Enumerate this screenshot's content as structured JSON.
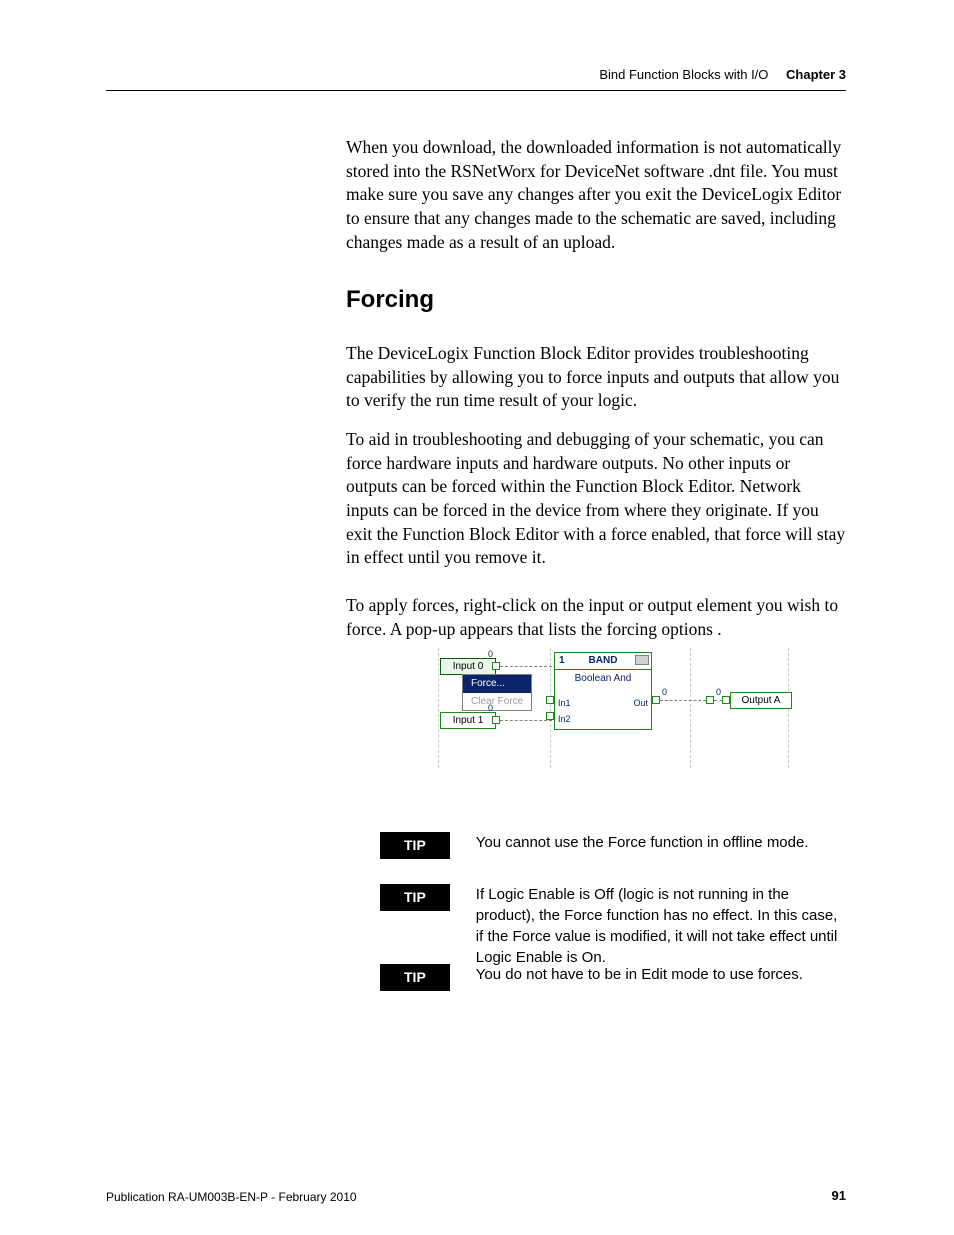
{
  "header": {
    "section": "Bind Function Blocks with I/O",
    "chapter": "Chapter 3"
  },
  "body": {
    "p1": "When you download, the downloaded information is not automatically stored into the RSNetWorx for DeviceNet software .dnt file. You must make sure you save any changes after you exit the DeviceLogix Editor to ensure that any changes made to the schematic are saved, including changes made as a result of an upload.",
    "h2": "Forcing",
    "p2": "The DeviceLogix Function Block Editor provides troubleshooting capabilities by allowing you to force inputs and outputs that allow you to verify the run time result of your logic.",
    "p3": "To aid in troubleshooting and debugging of your schematic, you can force hardware inputs and hardware outputs. No other inputs or outputs can be forced within the Function Block Editor. Network inputs can be forced in the device from where they originate. If you exit the Function Block Editor with a force enabled, that force will stay in effect until you remove it.",
    "p4": "To apply forces, right-click on the input or output element you wish to force. A pop-up appears that lists the forcing options ."
  },
  "diagram": {
    "input0": "Input 0",
    "input1": "Input 1",
    "menu_force": "Force...",
    "menu_clear": "Clear Force",
    "block_num": "1",
    "block_title": "BAND",
    "block_sub": "Boolean And",
    "pin_in1": "In1",
    "pin_in2": "In2",
    "pin_out": "Out",
    "output": "Output A",
    "zero": "0"
  },
  "tips": {
    "label": "TIP",
    "t1": "You cannot use the Force function in offline mode.",
    "t2": "If Logic Enable is Off (logic is not running in the product), the Force function has no effect. In this case, if the Force value is modified, it will not take effect until Logic Enable is On.",
    "t3": "You do not have to be in Edit mode to use forces."
  },
  "footer": {
    "pub": "Publication RA-UM003B-EN-P - February 2010",
    "page": "91"
  }
}
